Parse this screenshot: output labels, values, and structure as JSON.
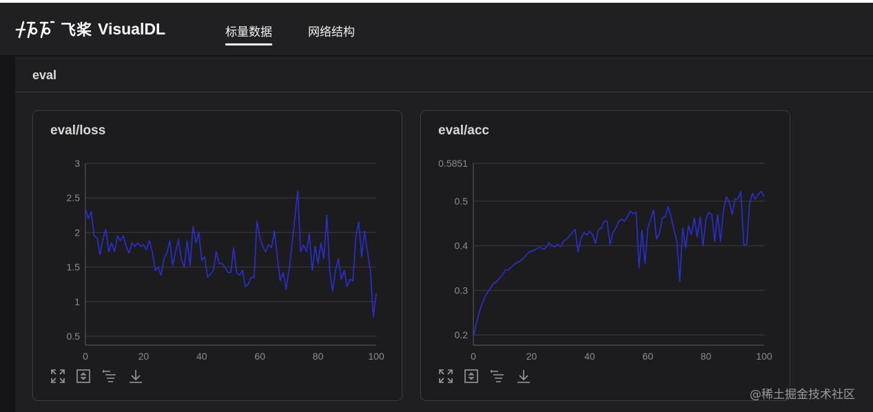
{
  "app": {
    "brand_cn": "飞桨",
    "brand_en": "VisualDL"
  },
  "nav": {
    "items": [
      {
        "label": "标量数据",
        "active": true
      },
      {
        "label": "网络结构",
        "active": false
      }
    ]
  },
  "section": {
    "title": "eval"
  },
  "charts": [
    {
      "title": "eval/loss",
      "chart_data": {
        "type": "line",
        "xlim": [
          0,
          100
        ],
        "ylim": [
          0.37,
          3
        ],
        "x_ticks": [
          "0",
          "20",
          "40",
          "60",
          "80",
          "100"
        ],
        "y_ticks": [
          "0.5",
          "1",
          "1.5",
          "2",
          "2.5",
          "3"
        ],
        "y_tick_values": [
          0.5,
          1,
          1.5,
          2,
          2.5,
          3
        ],
        "grid": true,
        "line_color": "#2a2fd4",
        "series": [
          {
            "values": [
              2.35,
              2.2,
              2.3,
              1.95,
              1.92,
              1.68,
              1.9,
              2.05,
              1.72,
              1.85,
              1.72,
              1.95,
              1.88,
              1.95,
              1.8,
              1.7,
              1.85,
              1.8,
              1.85,
              1.8,
              1.82,
              1.75,
              1.88,
              1.72,
              1.45,
              1.5,
              1.38,
              1.62,
              1.7,
              1.88,
              1.52,
              1.72,
              1.9,
              1.6,
              1.5,
              1.88,
              1.52,
              2.08,
              1.85,
              2.0,
              1.6,
              1.65,
              1.35,
              1.4,
              1.45,
              1.72,
              1.55,
              1.55,
              1.5,
              1.42,
              1.42,
              1.78,
              1.42,
              1.38,
              1.45,
              1.22,
              1.25,
              1.35,
              1.35,
              2.17,
              1.92,
              1.8,
              1.72,
              1.82,
              1.78,
              2.02,
              1.65,
              1.3,
              1.42,
              1.18,
              1.45,
              1.8,
              2.2,
              2.6,
              1.72,
              1.82,
              1.72,
              1.98,
              1.45,
              1.8,
              1.55,
              1.85,
              1.62,
              2.25,
              1.45,
              1.15,
              1.45,
              1.62,
              1.32,
              1.45,
              1.22,
              1.32,
              1.3,
              1.95,
              2.15,
              1.65,
              2.02,
              1.72,
              1.45,
              0.78,
              1.12
            ]
          }
        ]
      }
    },
    {
      "title": "eval/acc",
      "chart_data": {
        "type": "line",
        "xlim": [
          0,
          100
        ],
        "ylim": [
          0.177,
          0.5851
        ],
        "x_ticks": [
          "0",
          "20",
          "40",
          "60",
          "80",
          "100"
        ],
        "y_ticks": [
          "0.2",
          "0.3",
          "0.4",
          "0.5",
          "0.5851"
        ],
        "y_tick_values": [
          0.2,
          0.3,
          0.4,
          0.5,
          0.5851
        ],
        "grid": true,
        "line_color": "#2a2fd4",
        "series": [
          {
            "values": [
              0.195,
              0.225,
              0.25,
              0.27,
              0.285,
              0.297,
              0.306,
              0.315,
              0.32,
              0.327,
              0.335,
              0.345,
              0.346,
              0.352,
              0.358,
              0.362,
              0.365,
              0.371,
              0.378,
              0.385,
              0.388,
              0.39,
              0.394,
              0.397,
              0.392,
              0.396,
              0.407,
              0.4,
              0.398,
              0.403,
              0.398,
              0.41,
              0.415,
              0.422,
              0.43,
              0.437,
              0.386,
              0.415,
              0.43,
              0.424,
              0.432,
              0.425,
              0.405,
              0.436,
              0.44,
              0.455,
              0.455,
              0.403,
              0.43,
              0.44,
              0.455,
              0.46,
              0.455,
              0.465,
              0.478,
              0.472,
              0.475,
              0.35,
              0.435,
              0.36,
              0.44,
              0.46,
              0.48,
              0.415,
              0.428,
              0.463,
              0.465,
              0.488,
              0.465,
              0.435,
              0.41,
              0.32,
              0.44,
              0.395,
              0.445,
              0.425,
              0.462,
              0.42,
              0.465,
              0.4,
              0.46,
              0.475,
              0.47,
              0.41,
              0.47,
              0.41,
              0.478,
              0.51,
              0.498,
              0.47,
              0.505,
              0.505,
              0.522,
              0.403,
              0.403,
              0.495,
              0.518,
              0.505,
              0.515,
              0.522,
              0.51
            ]
          }
        ]
      }
    }
  ],
  "toolbar": {
    "icons": [
      "fullscreen-icon",
      "restore-icon",
      "filter-icon",
      "download-icon"
    ]
  },
  "watermark": "@稀土掘金技术社区"
}
